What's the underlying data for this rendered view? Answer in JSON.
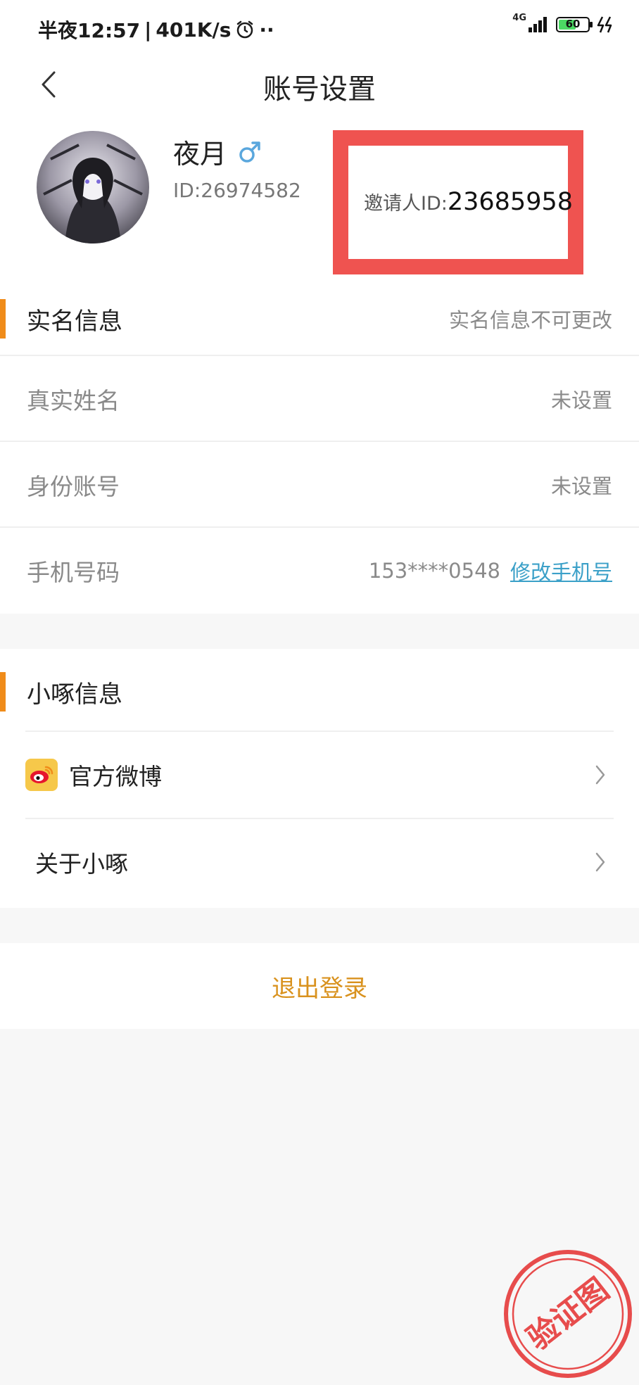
{
  "status_bar": {
    "time": "半夜12:57",
    "separator": "|",
    "net_speed": "401K/s",
    "extra_dots": "··",
    "network": "4G",
    "battery_level": "60",
    "battery_fraction": 0.6
  },
  "header": {
    "title": "账号设置"
  },
  "profile": {
    "nickname": "夜月",
    "gender_symbol": "♂",
    "user_id": "ID:26974582",
    "inviter_label": "邀请人ID:",
    "inviter_id": "23685958"
  },
  "real_name_section": {
    "title": "实名信息",
    "note": "实名信息不可更改",
    "rows": [
      {
        "label": "真实姓名",
        "value": "未设置"
      },
      {
        "label": "身份账号",
        "value": "未设置"
      },
      {
        "label": "手机号码",
        "value": "153****0548",
        "action": "修改手机号"
      }
    ]
  },
  "info_section": {
    "title": "小啄信息",
    "items": [
      {
        "label": "官方微博",
        "icon": "weibo-icon"
      },
      {
        "label": "关于小啄"
      }
    ]
  },
  "logout": {
    "label": "退出登录"
  },
  "stamp": {
    "text": "验证图"
  },
  "colors": {
    "accent_orange": "#f08c1a",
    "logout_text": "#d9921e",
    "link_blue": "#3ba0c8",
    "highlight_red": "#ef5350",
    "gender_blue": "#5aa7dd"
  }
}
